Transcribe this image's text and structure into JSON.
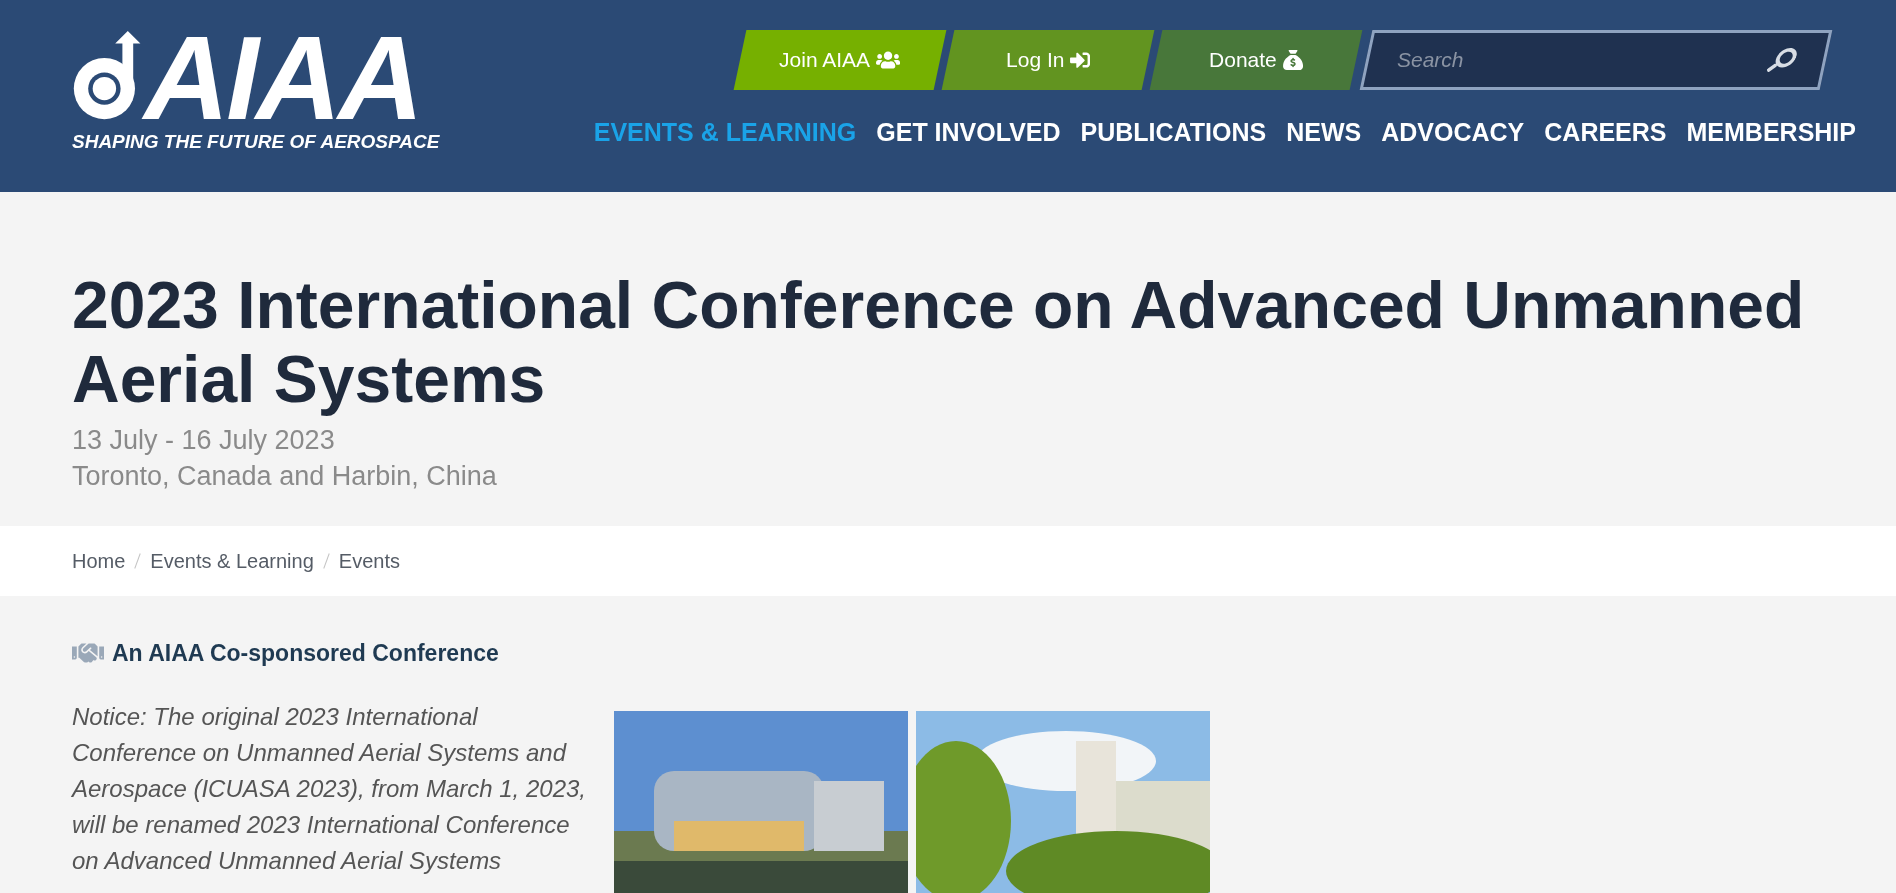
{
  "header": {
    "logo": {
      "wordmark": "AIAA",
      "tagline": "SHAPING THE FUTURE OF AEROSPACE"
    },
    "buttons": [
      {
        "label": "Join AIAA",
        "kind": "join",
        "color": "#76b000"
      },
      {
        "label": "Log In",
        "kind": "login",
        "color": "#629420"
      },
      {
        "label": "Donate",
        "kind": "donate",
        "color": "#48773a"
      }
    ],
    "search": {
      "placeholder": "Search"
    },
    "nav": [
      {
        "label": "EVENTS & LEARNING",
        "selected": true
      },
      {
        "label": "GET INVOLVED",
        "selected": false
      },
      {
        "label": "PUBLICATIONS",
        "selected": false
      },
      {
        "label": "NEWS",
        "selected": false
      },
      {
        "label": "ADVOCACY",
        "selected": false
      },
      {
        "label": "CAREERS",
        "selected": false
      },
      {
        "label": "MEMBERSHIP",
        "selected": false
      }
    ]
  },
  "event": {
    "title": "2023 International Conference on Advanced Unmanned Aerial Systems",
    "dates": "13 July - 16 July 2023",
    "location": "Toronto, Canada and Harbin, China"
  },
  "breadcrumb": [
    "Home",
    "Events & Learning",
    "Events"
  ],
  "sponsorship": "An AIAA Co-sponsored Conference",
  "notice": "Notice: The original 2023 International Conference on Unmanned Aerial Systems and Aerospace (ICUASA 2023), from March 1, 2023, will be renamed 2023 International Conference on Advanced Unmanned Aerial Systems",
  "photos": [
    {
      "kind": "building"
    },
    {
      "kind": "tower"
    }
  ]
}
